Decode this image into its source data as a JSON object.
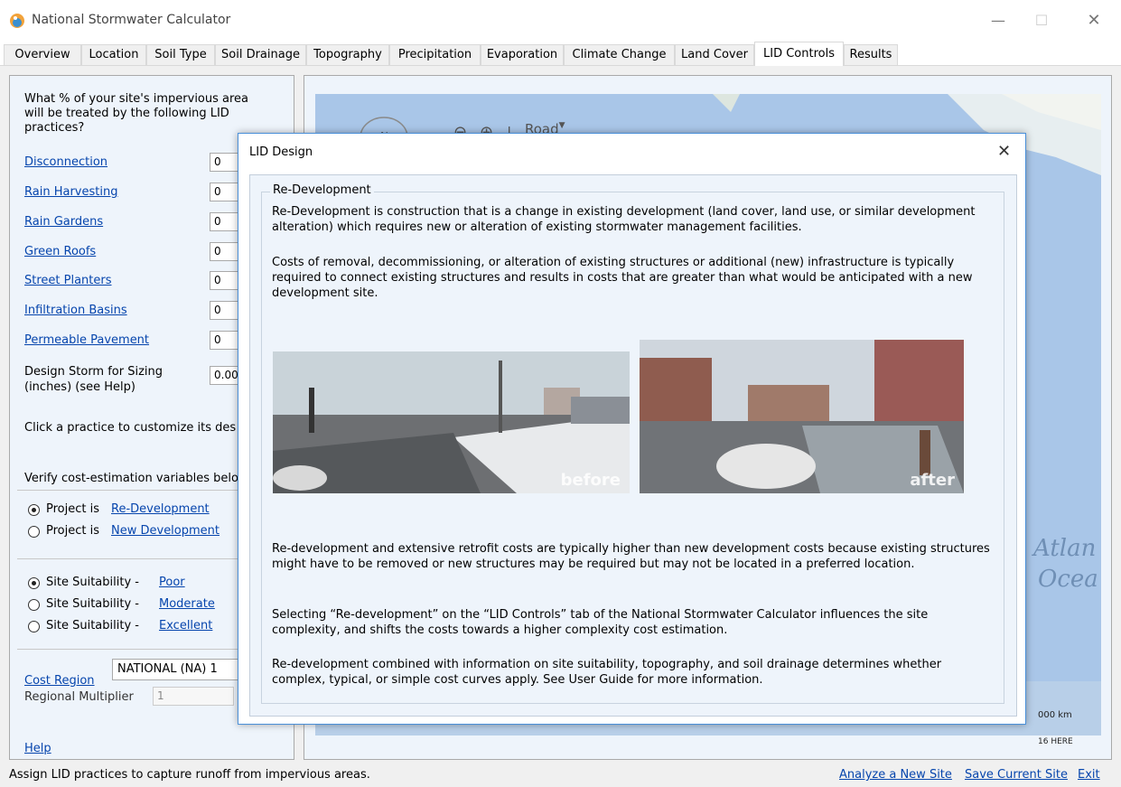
{
  "window": {
    "title": "National Stormwater Calculator",
    "minimize": "—",
    "maximize": "☐",
    "close": "✕"
  },
  "tabs": [
    {
      "label": "Overview"
    },
    {
      "label": "Location"
    },
    {
      "label": "Soil Type"
    },
    {
      "label": "Soil Drainage"
    },
    {
      "label": "Topography"
    },
    {
      "label": "Precipitation"
    },
    {
      "label": "Evaporation"
    },
    {
      "label": "Climate Change"
    },
    {
      "label": "Land Cover"
    },
    {
      "label": "LID Controls"
    },
    {
      "label": "Results"
    }
  ],
  "left_panel": {
    "question_line1": "What % of your site's impervious area",
    "question_line2": "will be treated by the following LID",
    "question_line3": "practices?",
    "practices": [
      {
        "label": "Disconnection",
        "value": "0"
      },
      {
        "label": "Rain Harvesting",
        "value": "0"
      },
      {
        "label": "Rain Gardens",
        "value": "0"
      },
      {
        "label": "Green Roofs",
        "value": "0"
      },
      {
        "label": "Street Planters",
        "value": "0"
      },
      {
        "label": "Infiltration Basins",
        "value": "0"
      },
      {
        "label": "Permeable Pavement",
        "value": "0"
      }
    ],
    "design_storm_line1": "Design Storm for Sizing",
    "design_storm_line2": "(inches) (see Help)",
    "design_storm_value": "0.00",
    "click_hint": "Click a practice to customize its des",
    "verify_text": "Verify cost-estimation variables belo",
    "project_prefix": "Project is",
    "project_options": [
      {
        "label": "Re-Development",
        "selected": true
      },
      {
        "label": "New Development",
        "selected": false
      }
    ],
    "suitability_prefix": "Site Suitability -",
    "suitability_options": [
      {
        "label": "Poor",
        "selected": true
      },
      {
        "label": "Moderate",
        "selected": false
      },
      {
        "label": "Excellent",
        "selected": false
      }
    ],
    "cost_region_label": "Cost Region",
    "cost_region_value": "NATIONAL (NA) 1",
    "regional_multiplier_label": "Regional Multiplier",
    "regional_multiplier_value": "1",
    "help": "Help"
  },
  "map": {
    "nav_label": "N",
    "zoom_out": "⊖",
    "zoom_in": "⊕",
    "separator": "|",
    "road": "Road",
    "ocean_line1": "Atlan",
    "ocean_line2": "Ocea",
    "scale": "000 km",
    "copyright": "16 HERE"
  },
  "dialog": {
    "title": "LID Design",
    "close": "✕",
    "section": "Re-Development",
    "para1": "Re-Development is construction that is a change in existing development (land cover, land use, or similar development alteration) which requires new or alteration of existing stormwater management facilities.",
    "para2": "Costs of removal, decommissioning, or alteration of existing structures or additional (new) infrastructure is typically required to connect existing structures and results in costs that are greater than what would be anticipated with a new development site.",
    "photo_before": "before",
    "photo_after": "after",
    "para3": "Re-development and extensive retrofit costs are typically higher than new development costs because existing structures might have to be removed or new structures may be required but may not be located in a preferred location.",
    "para4": "Selecting “Re-development” on the “LID Controls” tab of the National Stormwater Calculator influences the site complexity, and shifts the costs towards a higher complexity cost estimation.",
    "para5": "Re-development combined with information on site suitability, topography, and soil drainage determines whether complex, typical, or simple cost curves apply. See User Guide for more information."
  },
  "status": {
    "text": "Assign LID practices to capture runoff from impervious areas.",
    "analyze": "Analyze a New Site",
    "save": "Save Current Site",
    "exit": "Exit"
  }
}
